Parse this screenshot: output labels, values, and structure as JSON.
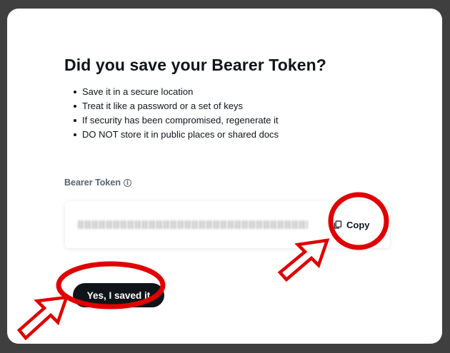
{
  "dialog": {
    "title": "Did you save your Bearer Token?",
    "bullets": [
      "Save it in a secure location",
      "Treat it like a password or a set of keys",
      "If security has been compromised, regenerate it",
      "DO NOT store it in public places or shared docs"
    ]
  },
  "token": {
    "label": "Bearer Token",
    "info_icon": "info-circle-icon",
    "value_masked": "••••••••••••••••••••••••••••••••••••••••••••••••••",
    "copy_label": "Copy",
    "copy_icon": "copy-icon"
  },
  "actions": {
    "confirm_label": "Yes, I saved it"
  },
  "annotations": {
    "color": "#e00000",
    "marks": [
      "red-circle-copy",
      "red-circle-confirm",
      "red-arrow-copy",
      "red-arrow-confirm"
    ]
  },
  "colors": {
    "backdrop": "#3f3f3f",
    "modal": "#ffffff",
    "text": "#0f1419",
    "label": "#536471",
    "button_dark": "#0f1419"
  }
}
